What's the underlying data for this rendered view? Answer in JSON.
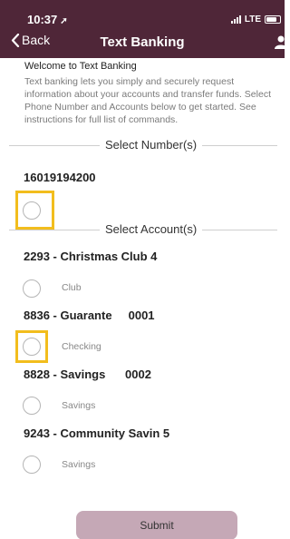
{
  "status_bar": {
    "time": "10:37",
    "network": "LTE"
  },
  "nav": {
    "back_label": "Back",
    "title": "Text Banking"
  },
  "intro": {
    "welcome": "Welcome to Text Banking",
    "description": "Text banking lets you simply and securely request information about your accounts and transfer funds. Select Phone Number and Accounts below to get started. See instructions for full list of commands."
  },
  "numbers_section": {
    "label": "Select Number(s)",
    "numbers": [
      {
        "number": "16019194200",
        "selected": false
      }
    ]
  },
  "accounts_section": {
    "label": "Select Account(s)",
    "accounts": [
      {
        "title": "2293 - Christmas Club 4",
        "type": "Club",
        "selected": false
      },
      {
        "title": "8836 - Guarante     0001",
        "type": "Checking",
        "selected": false
      },
      {
        "title": "8828 - Savings      0002",
        "type": "Savings",
        "selected": false
      },
      {
        "title": "9243 - Community Savin 5",
        "type": "Savings",
        "selected": false
      }
    ]
  },
  "submit_label": "Submit",
  "colors": {
    "header": "#4f2638",
    "highlight": "#f2bd1d",
    "submit": "#c5a8b6"
  }
}
